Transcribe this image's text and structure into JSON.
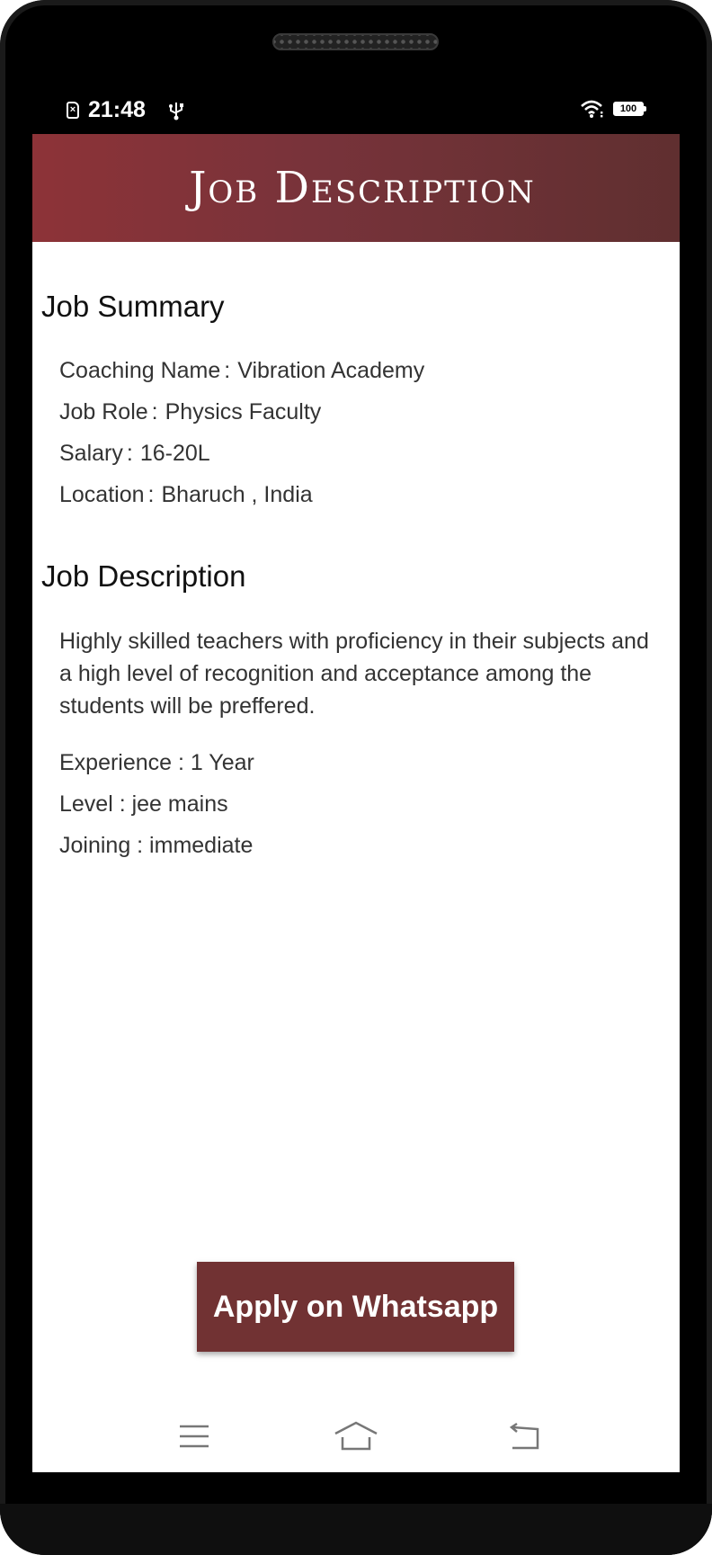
{
  "status_bar": {
    "time": "21:48",
    "battery": "100",
    "icons": [
      "sim-error-icon",
      "usb-icon",
      "wifi-icon",
      "battery-icon"
    ]
  },
  "header": {
    "title": "Job Description"
  },
  "job_summary": {
    "heading": "Job Summary",
    "separator": ":",
    "items": [
      {
        "label": "Coaching Name",
        "value": "Vibration Academy"
      },
      {
        "label": "Job Role",
        "value": "Physics Faculty"
      },
      {
        "label": "Salary",
        "value": "16-20L"
      },
      {
        "label": "Location",
        "value": "Bharuch , India"
      }
    ]
  },
  "job_description": {
    "heading": "Job Description",
    "paragraph": "Highly skilled teachers with proficiency in their subjects and a high level of recognition and acceptance among the students will be preffered.",
    "details": [
      "Experience : 1 Year",
      "Level : jee mains",
      "Joining : immediate"
    ]
  },
  "apply_button": {
    "label": "Apply on Whatsapp"
  },
  "nav_bar": {
    "icons": [
      "menu-icon",
      "home-icon",
      "back-icon"
    ]
  },
  "colors": {
    "header_start": "#8d3338",
    "header_end": "#602f30",
    "button": "#713233",
    "text": "#333333",
    "heading": "#111111"
  }
}
